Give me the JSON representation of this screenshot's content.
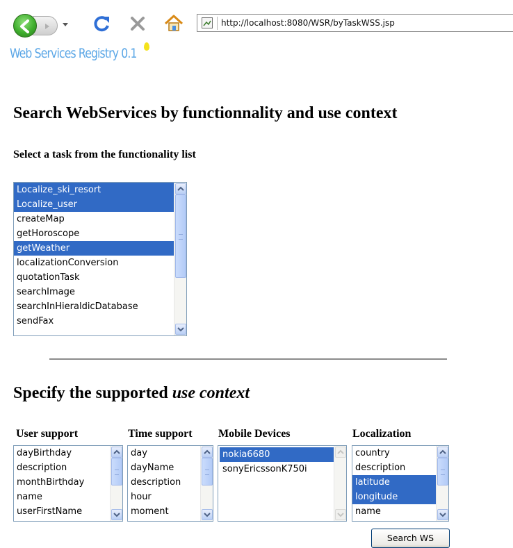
{
  "browser": {
    "url": "http://localhost:8080/WSR/byTaskWSS.jsp",
    "icons": [
      "back-arrow-icon",
      "forward-arrow-icon",
      "dropdown-icon",
      "reload-icon",
      "stop-icon",
      "home-icon",
      "page-icon"
    ]
  },
  "logo": {
    "text": "Web Services Registry 0.1"
  },
  "page": {
    "title": "Search WebServices by functionnality and use context",
    "task_label": "Select a task from the functionality list",
    "context_title_prefix": "Specify the supported ",
    "context_title_em": "use context"
  },
  "task_list": {
    "items": [
      {
        "label": "Localize_ski_resort",
        "selected": true
      },
      {
        "label": "Localize_user",
        "selected": true
      },
      {
        "label": "createMap",
        "selected": false
      },
      {
        "label": "getHoroscope",
        "selected": false
      },
      {
        "label": "getWeather",
        "selected": true
      },
      {
        "label": "localizationConversion",
        "selected": false
      },
      {
        "label": "quotationTask",
        "selected": false
      },
      {
        "label": "searchImage",
        "selected": false
      },
      {
        "label": "searchInHieraldicDatabase",
        "selected": false
      },
      {
        "label": "sendFax",
        "selected": false
      }
    ]
  },
  "context": {
    "user_support": {
      "label": "User support",
      "items": [
        {
          "label": "dayBirthday",
          "selected": false
        },
        {
          "label": "description",
          "selected": false
        },
        {
          "label": "monthBirthday",
          "selected": false
        },
        {
          "label": "name",
          "selected": false
        },
        {
          "label": "userFirstName",
          "selected": false
        }
      ]
    },
    "time_support": {
      "label": "Time support",
      "items": [
        {
          "label": "day",
          "selected": false
        },
        {
          "label": "dayName",
          "selected": false
        },
        {
          "label": "description",
          "selected": false
        },
        {
          "label": "hour",
          "selected": false
        },
        {
          "label": "moment",
          "selected": false
        }
      ]
    },
    "mobile_devices": {
      "label": "Mobile Devices",
      "items": [
        {
          "label": "nokia6680",
          "selected": true
        },
        {
          "label": "sonyEricssonK750i",
          "selected": false
        }
      ]
    },
    "localization": {
      "label": "Localization",
      "items": [
        {
          "label": "country",
          "selected": false
        },
        {
          "label": "description",
          "selected": false
        },
        {
          "label": "latitude",
          "selected": true
        },
        {
          "label": "longitude",
          "selected": true
        },
        {
          "label": "name",
          "selected": false
        }
      ]
    }
  },
  "search_button": {
    "label": "Search WS"
  },
  "colors": {
    "selection": "#316ac5",
    "logo": "#5aa6e6"
  }
}
